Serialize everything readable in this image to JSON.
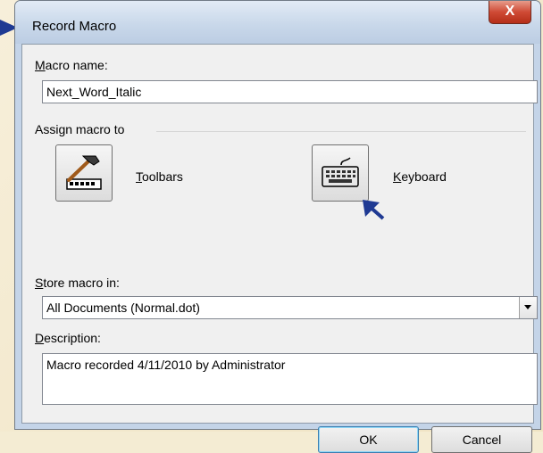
{
  "window": {
    "title": "Record Macro",
    "close_symbol": "X"
  },
  "macro_name": {
    "label_accel": "M",
    "label_rest": "acro name:",
    "value": "Next_Word_Italic"
  },
  "assign": {
    "heading": "Assign macro to",
    "toolbars": {
      "accel": "T",
      "rest": "oolbars",
      "icon": "hammer-icon"
    },
    "keyboard": {
      "accel": "K",
      "rest": "eyboard",
      "icon": "keyboard-icon"
    }
  },
  "store": {
    "label_accel": "S",
    "label_rest": "tore macro in:",
    "selected": "All Documents (Normal.dot)"
  },
  "description": {
    "label_accel": "D",
    "label_rest": "escription:",
    "value": "Macro recorded 4/11/2010 by Administrator"
  },
  "buttons": {
    "ok": "OK",
    "cancel": "Cancel"
  },
  "colors": {
    "annotation_arrow": "#1f3a93",
    "close_button": "#c9402b"
  }
}
